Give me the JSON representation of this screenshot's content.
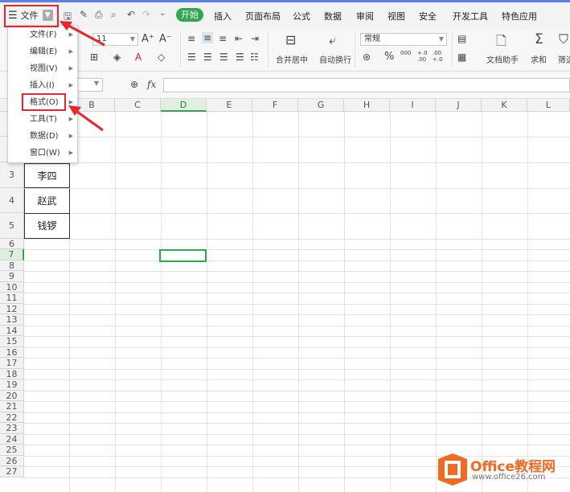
{
  "menubar": {
    "file_label": "文件",
    "tabs": [
      "开始",
      "插入",
      "页面布局",
      "公式",
      "数据",
      "审阅",
      "视图",
      "安全",
      "开发工具",
      "特色应用"
    ]
  },
  "ribbon": {
    "font_size": "11",
    "number_format": "常规",
    "merge_center": "合并居中",
    "auto_wrap": "自动换行",
    "doc_assistant": "文档助手",
    "sum": "求和",
    "filter": "筛选",
    "percent": "%",
    "thousands": "000",
    "decimal_add": "+.0 .00",
    "decimal_remove": ".00 +.0"
  },
  "formula_bar": {
    "fx": "fx"
  },
  "file_menu": {
    "items": [
      "文件(F)",
      "编辑(E)",
      "视图(V)",
      "插入(I)",
      "格式(O)",
      "工具(T)",
      "数据(D)",
      "窗口(W)"
    ]
  },
  "sheet": {
    "columns": [
      "B",
      "C",
      "D",
      "E",
      "F",
      "G",
      "H",
      "I",
      "J",
      "K",
      "L"
    ],
    "rows": [
      "3",
      "4",
      "5",
      "6",
      "7",
      "8",
      "9",
      "10",
      "11",
      "12",
      "13",
      "14",
      "15",
      "16",
      "17",
      "18",
      "19",
      "20",
      "21",
      "22",
      "23",
      "24",
      "25",
      "26",
      "27"
    ],
    "names": [
      "李四",
      "赵武",
      "钱锣"
    ]
  },
  "watermark": {
    "title": "Office教程网",
    "url": "www.office26.com"
  },
  "colors": {
    "accent": "#2fa84f",
    "highlight": "#e8262b",
    "brand": "#f26a21"
  }
}
